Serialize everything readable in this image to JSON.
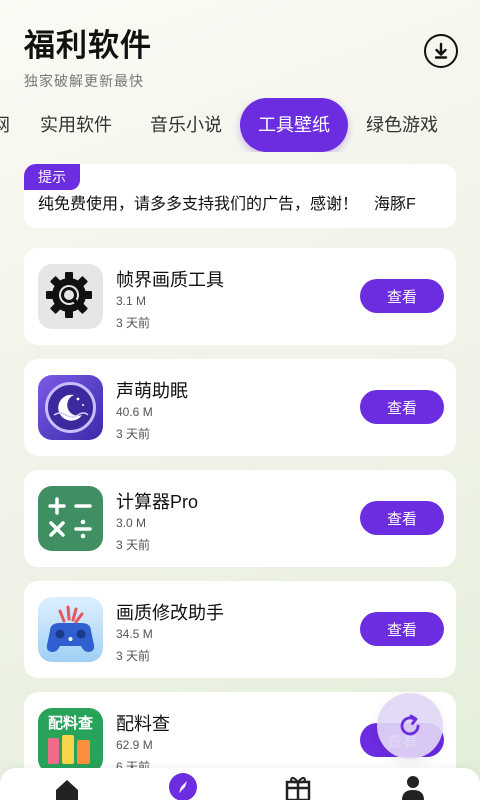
{
  "header": {
    "title": "福利软件",
    "subtitle": "独家破解更新最快"
  },
  "icons": {
    "download": "download-icon",
    "refresh": "refresh-icon",
    "home": "home-icon",
    "discover": "compass-icon",
    "gift": "gift-icon",
    "profile": "user-icon"
  },
  "tabs": [
    {
      "label": "网",
      "active": false
    },
    {
      "label": "实用软件",
      "active": false
    },
    {
      "label": "音乐小说",
      "active": false
    },
    {
      "label": "工具壁纸",
      "active": true
    },
    {
      "label": "绿色游戏",
      "active": false
    }
  ],
  "notice": {
    "badge": "提示",
    "text": "纯免费使用，请多多支持我们的广告，感谢！　海豚F"
  },
  "apps": [
    {
      "name": "帧界画质工具",
      "size": "3.1 M",
      "time": "3 天前",
      "button": "查看",
      "icon": "gear-search-icon"
    },
    {
      "name": "声萌助眠",
      "size": "40.6 M",
      "time": "3 天前",
      "button": "查看",
      "icon": "moon-icon"
    },
    {
      "name": "计算器Pro",
      "size": "3.0 M",
      "time": "3 天前",
      "button": "查看",
      "icon": "calculator-icon"
    },
    {
      "name": "画质修改助手",
      "size": "34.5 M",
      "time": "3 天前",
      "button": "查看",
      "icon": "gamepad-icon"
    },
    {
      "name": "配料查",
      "size": "62.9 M",
      "time": "6 天前",
      "button": "查看",
      "icon": "ingredients-icon",
      "icon_text": "配料查"
    }
  ],
  "colors": {
    "accent": "#6c2ce0",
    "card": "#ffffff"
  }
}
